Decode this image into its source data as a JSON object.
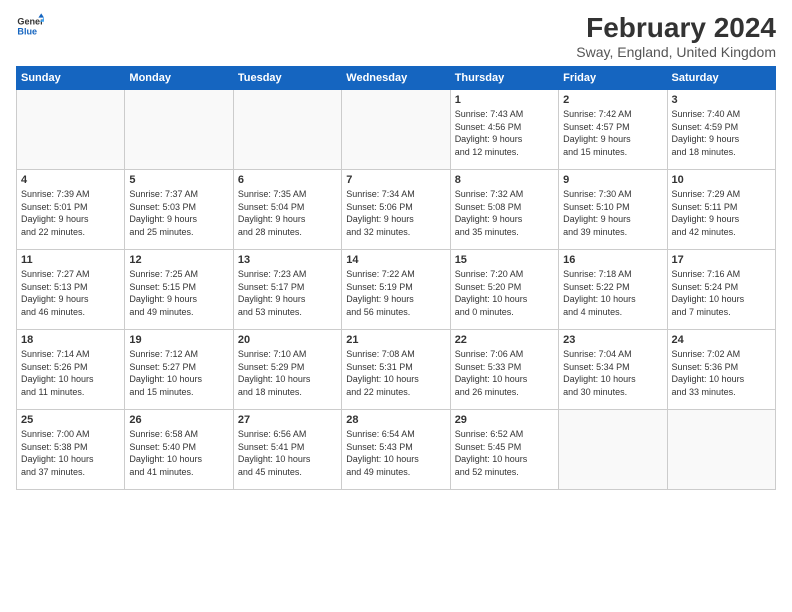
{
  "header": {
    "logo_line1": "General",
    "logo_line2": "Blue",
    "title": "February 2024",
    "subtitle": "Sway, England, United Kingdom"
  },
  "weekdays": [
    "Sunday",
    "Monday",
    "Tuesday",
    "Wednesday",
    "Thursday",
    "Friday",
    "Saturday"
  ],
  "weeks": [
    [
      {
        "day": "",
        "detail": ""
      },
      {
        "day": "",
        "detail": ""
      },
      {
        "day": "",
        "detail": ""
      },
      {
        "day": "",
        "detail": ""
      },
      {
        "day": "1",
        "detail": "Sunrise: 7:43 AM\nSunset: 4:56 PM\nDaylight: 9 hours\nand 12 minutes."
      },
      {
        "day": "2",
        "detail": "Sunrise: 7:42 AM\nSunset: 4:57 PM\nDaylight: 9 hours\nand 15 minutes."
      },
      {
        "day": "3",
        "detail": "Sunrise: 7:40 AM\nSunset: 4:59 PM\nDaylight: 9 hours\nand 18 minutes."
      }
    ],
    [
      {
        "day": "4",
        "detail": "Sunrise: 7:39 AM\nSunset: 5:01 PM\nDaylight: 9 hours\nand 22 minutes."
      },
      {
        "day": "5",
        "detail": "Sunrise: 7:37 AM\nSunset: 5:03 PM\nDaylight: 9 hours\nand 25 minutes."
      },
      {
        "day": "6",
        "detail": "Sunrise: 7:35 AM\nSunset: 5:04 PM\nDaylight: 9 hours\nand 28 minutes."
      },
      {
        "day": "7",
        "detail": "Sunrise: 7:34 AM\nSunset: 5:06 PM\nDaylight: 9 hours\nand 32 minutes."
      },
      {
        "day": "8",
        "detail": "Sunrise: 7:32 AM\nSunset: 5:08 PM\nDaylight: 9 hours\nand 35 minutes."
      },
      {
        "day": "9",
        "detail": "Sunrise: 7:30 AM\nSunset: 5:10 PM\nDaylight: 9 hours\nand 39 minutes."
      },
      {
        "day": "10",
        "detail": "Sunrise: 7:29 AM\nSunset: 5:11 PM\nDaylight: 9 hours\nand 42 minutes."
      }
    ],
    [
      {
        "day": "11",
        "detail": "Sunrise: 7:27 AM\nSunset: 5:13 PM\nDaylight: 9 hours\nand 46 minutes."
      },
      {
        "day": "12",
        "detail": "Sunrise: 7:25 AM\nSunset: 5:15 PM\nDaylight: 9 hours\nand 49 minutes."
      },
      {
        "day": "13",
        "detail": "Sunrise: 7:23 AM\nSunset: 5:17 PM\nDaylight: 9 hours\nand 53 minutes."
      },
      {
        "day": "14",
        "detail": "Sunrise: 7:22 AM\nSunset: 5:19 PM\nDaylight: 9 hours\nand 56 minutes."
      },
      {
        "day": "15",
        "detail": "Sunrise: 7:20 AM\nSunset: 5:20 PM\nDaylight: 10 hours\nand 0 minutes."
      },
      {
        "day": "16",
        "detail": "Sunrise: 7:18 AM\nSunset: 5:22 PM\nDaylight: 10 hours\nand 4 minutes."
      },
      {
        "day": "17",
        "detail": "Sunrise: 7:16 AM\nSunset: 5:24 PM\nDaylight: 10 hours\nand 7 minutes."
      }
    ],
    [
      {
        "day": "18",
        "detail": "Sunrise: 7:14 AM\nSunset: 5:26 PM\nDaylight: 10 hours\nand 11 minutes."
      },
      {
        "day": "19",
        "detail": "Sunrise: 7:12 AM\nSunset: 5:27 PM\nDaylight: 10 hours\nand 15 minutes."
      },
      {
        "day": "20",
        "detail": "Sunrise: 7:10 AM\nSunset: 5:29 PM\nDaylight: 10 hours\nand 18 minutes."
      },
      {
        "day": "21",
        "detail": "Sunrise: 7:08 AM\nSunset: 5:31 PM\nDaylight: 10 hours\nand 22 minutes."
      },
      {
        "day": "22",
        "detail": "Sunrise: 7:06 AM\nSunset: 5:33 PM\nDaylight: 10 hours\nand 26 minutes."
      },
      {
        "day": "23",
        "detail": "Sunrise: 7:04 AM\nSunset: 5:34 PM\nDaylight: 10 hours\nand 30 minutes."
      },
      {
        "day": "24",
        "detail": "Sunrise: 7:02 AM\nSunset: 5:36 PM\nDaylight: 10 hours\nand 33 minutes."
      }
    ],
    [
      {
        "day": "25",
        "detail": "Sunrise: 7:00 AM\nSunset: 5:38 PM\nDaylight: 10 hours\nand 37 minutes."
      },
      {
        "day": "26",
        "detail": "Sunrise: 6:58 AM\nSunset: 5:40 PM\nDaylight: 10 hours\nand 41 minutes."
      },
      {
        "day": "27",
        "detail": "Sunrise: 6:56 AM\nSunset: 5:41 PM\nDaylight: 10 hours\nand 45 minutes."
      },
      {
        "day": "28",
        "detail": "Sunrise: 6:54 AM\nSunset: 5:43 PM\nDaylight: 10 hours\nand 49 minutes."
      },
      {
        "day": "29",
        "detail": "Sunrise: 6:52 AM\nSunset: 5:45 PM\nDaylight: 10 hours\nand 52 minutes."
      },
      {
        "day": "",
        "detail": ""
      },
      {
        "day": "",
        "detail": ""
      }
    ]
  ]
}
